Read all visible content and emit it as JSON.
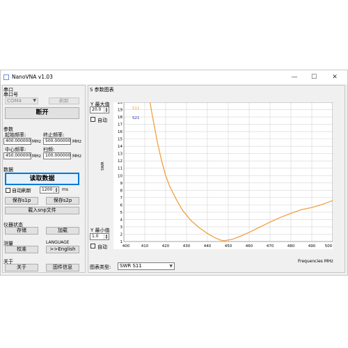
{
  "window": {
    "title": "NanoVNA v1.03",
    "min": "—",
    "max": "☐",
    "close": "✕"
  },
  "serial": {
    "group": "串口",
    "port_label": "串口号",
    "port_value": "COM4",
    "open_btn": "刷新",
    "disconnect_btn": "断开"
  },
  "params": {
    "group": "参数",
    "start_label": "起始频率:",
    "start_value": "400.000000",
    "start_unit": "MHz",
    "stop_label": "终止频率:",
    "stop_value": "500.000000",
    "stop_unit": "MHz",
    "center_label": "中心频率:",
    "center_value": "450.000000",
    "center_unit": "MHz",
    "span_label": "扫频:",
    "span_value": "100.000000",
    "span_unit": "MHz"
  },
  "data": {
    "group": "数据",
    "read_btn": "读取数据",
    "auto_refresh": "自动刷新",
    "interval_value": "1200",
    "interval_unit": "ms",
    "save_s1p": "保存s1p",
    "save_s2p": "保存s2p",
    "load_snp": "载入snp文件"
  },
  "device": {
    "group": "仪器状态",
    "save_btn": "存储",
    "load_btn": "加载"
  },
  "measure": {
    "group": "测量",
    "calib_btn": "校准"
  },
  "language": {
    "group": "LANGUAGE",
    "english_btn": ">>English"
  },
  "about": {
    "group": "关于",
    "about_btn": "关于",
    "firmware_btn": "固件信息"
  },
  "chart_panel": {
    "title": "S 参数图表",
    "ymax_label": "Y 最大值",
    "ymax_value": "20.0",
    "ymin_label": "Y 最小值",
    "ymin_value": "1.0",
    "auto_label": "自动",
    "auto_label2": "自动",
    "chart_type_label": "图表类型:",
    "chart_type_value": "SWR S11"
  },
  "chart_data": {
    "type": "line",
    "xlabel": "Frequencies MHz",
    "ylabel": "SWR",
    "xlim": [
      400,
      500
    ],
    "ylim": [
      1,
      20
    ],
    "x_ticks": [
      400,
      410,
      420,
      430,
      440,
      450,
      460,
      470,
      480,
      490,
      500
    ],
    "y_ticks": [
      1,
      2,
      3,
      4,
      5,
      6,
      7,
      8,
      9,
      10,
      11,
      12,
      13,
      14,
      15,
      16,
      17,
      18,
      19,
      20
    ],
    "grid": true,
    "legend": "top-left",
    "series": [
      {
        "name": "S11",
        "color": "#f0a040",
        "x": [
          412.5,
          414,
          416,
          418,
          420,
          422,
          425,
          428,
          432,
          436,
          440,
          443,
          446,
          448,
          452,
          456,
          460,
          465,
          470,
          475,
          480,
          485,
          490,
          495,
          500
        ],
        "y": [
          20,
          17.6,
          14.6,
          12.1,
          10.0,
          8.5,
          6.8,
          5.3,
          3.9,
          2.9,
          2.1,
          1.6,
          1.22,
          1.1,
          1.3,
          1.75,
          2.25,
          2.95,
          3.65,
          4.3,
          4.85,
          5.35,
          5.65,
          6.05,
          6.6
        ]
      },
      {
        "name": "S21",
        "color": "#2a2ac0",
        "x": [],
        "y": []
      }
    ]
  }
}
